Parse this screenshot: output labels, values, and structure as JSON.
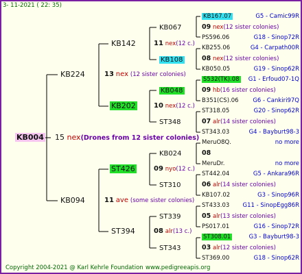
{
  "header": {
    "date": "3- 11-2021 ( 22: 35)"
  },
  "footer": {
    "copyright": "Copyright 2004-2021 @ Karl Kehrle Foundation",
    "url": "www.pedigreeapis.org"
  },
  "root": {
    "name": "KB004",
    "gen": "15",
    "race": "nex",
    "note": "(Drones from 12 sister colonies)"
  },
  "parents": [
    {
      "name": "KB224",
      "gen": "13",
      "race": "nex",
      "note": "(12 sister colonies)"
    },
    {
      "name": "KB094",
      "gen": "11",
      "race": "ave",
      "note": "(some sister colonies)"
    }
  ],
  "grandparents": [
    {
      "name": "KB142",
      "gen": "11",
      "race": "nex",
      "note": "(12 c.)"
    },
    {
      "name": "KB202",
      "gen": "10",
      "race": "nex",
      "note": "(12 c.)"
    },
    {
      "name": "ST426",
      "gen": "09",
      "race": "nyo",
      "note": "(12 c.)"
    },
    {
      "name": "ST394",
      "gen": "08",
      "race": "alr",
      "note": "(13 c.)"
    }
  ],
  "ggp": [
    {
      "name": "KB067",
      "gen": "",
      "race": "",
      "note": ""
    },
    {
      "name": "KB108",
      "gen": "",
      "race": "",
      "note": ""
    },
    {
      "name": "KB048",
      "gen": "",
      "race": "",
      "note": ""
    },
    {
      "name": "ST348",
      "gen": "07",
      "race": "alr",
      "note": "(14 c.)"
    },
    {
      "name": "KB024",
      "gen": "",
      "race": "",
      "note": ""
    },
    {
      "name": "ST310",
      "gen": "06",
      "race": "alr",
      "note": "(14 c.)"
    },
    {
      "name": "ST339",
      "gen": "05",
      "race": "alr",
      "note": "(13 c.)"
    },
    {
      "name": "ST343",
      "gen": "03",
      "race": "alr",
      "note": "(12 c.)"
    }
  ],
  "gggp": [
    {
      "name": "KB167.07",
      "gen": "",
      "race": "",
      "note": "",
      "code": "G5 - Camic99R"
    },
    {
      "name": "",
      "gen": "09",
      "race": "nex",
      "note": "(12 sister colonies)",
      "code": ""
    },
    {
      "name": "PS596.06",
      "gen": "",
      "race": "",
      "note": "",
      "code": "G18 - Sinop72R"
    },
    {
      "name": "KB255.06",
      "gen": "",
      "race": "",
      "note": "",
      "code": "G4 - Carpath00R"
    },
    {
      "name": "",
      "gen": "08",
      "race": "nex",
      "note": "(12 sister colonies)",
      "code": ""
    },
    {
      "name": "KB050.05",
      "gen": "",
      "race": "",
      "note": "",
      "code": "G19 - Sinop62R"
    },
    {
      "name": "S532(TK).08",
      "gen": "",
      "race": "",
      "note": "",
      "code": "G1 - Erfoud07-1Q"
    },
    {
      "name": "",
      "gen": "09",
      "race": "hb",
      "note": "(16 sister colonies)",
      "code": ""
    },
    {
      "name": "B351(CS).06",
      "gen": "",
      "race": "",
      "note": "",
      "code": "G6 - Cankiri97Q"
    },
    {
      "name": "ST318.05",
      "gen": "",
      "race": "",
      "note": "",
      "code": "G20 - Sinop62R"
    },
    {
      "name": "",
      "gen": "07",
      "race": "alr",
      "note": "(14 sister colonies)",
      "code": ""
    },
    {
      "name": "ST343.03",
      "gen": "",
      "race": "",
      "note": "",
      "code": "G4 - Bayburt98-3"
    },
    {
      "name": "MeruO8Q.",
      "gen": "",
      "race": "",
      "note": "",
      "code": "no more"
    },
    {
      "name": "",
      "gen": "08",
      "race": "",
      "note": "",
      "code": ""
    },
    {
      "name": "MeruDr.",
      "gen": "",
      "race": "",
      "note": "",
      "code": "no more"
    },
    {
      "name": "ST442.04",
      "gen": "",
      "race": "",
      "note": "",
      "code": "G5 - Ankara96R"
    },
    {
      "name": "",
      "gen": "06",
      "race": "alr",
      "note": "(14 sister colonies)",
      "code": ""
    },
    {
      "name": "KB107.02",
      "gen": "",
      "race": "",
      "note": "",
      "code": "G3 - Sinop96R"
    },
    {
      "name": "ST433.03",
      "gen": "",
      "race": "",
      "note": "",
      "code": "G11 - SinopEgg86R"
    },
    {
      "name": "",
      "gen": "05",
      "race": "alr",
      "note": "(13 sister colonies)",
      "code": ""
    },
    {
      "name": "PS017.01",
      "gen": "",
      "race": "",
      "note": "",
      "code": "G16 - Sinop72R"
    },
    {
      "name": "ST308.01",
      "gen": "",
      "race": "",
      "note": "",
      "code": "G3 - Bayburt98-3"
    },
    {
      "name": "",
      "gen": "03",
      "race": "alr",
      "note": "(12 sister colonies)",
      "code": ""
    },
    {
      "name": "ST369.00",
      "gen": "",
      "race": "",
      "note": "",
      "code": "G18 - Sinop62R"
    }
  ]
}
